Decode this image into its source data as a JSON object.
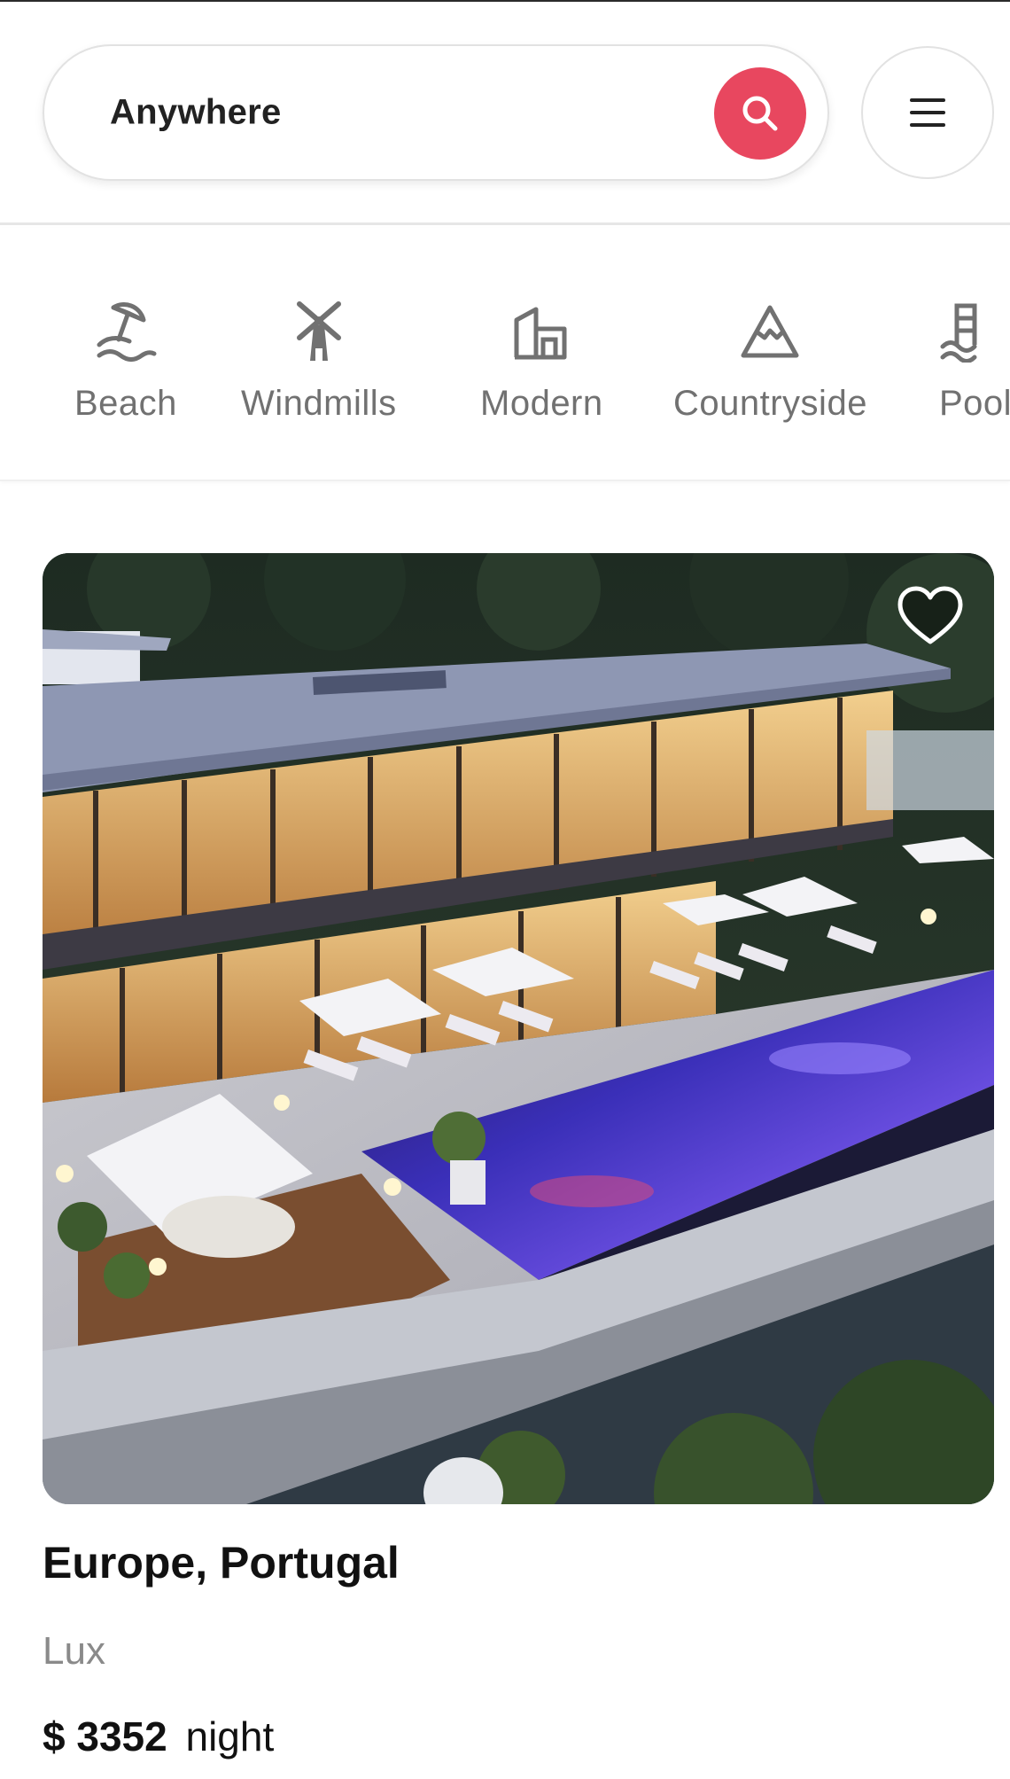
{
  "search": {
    "location_label": "Anywhere",
    "search_icon": "search-icon",
    "menu_icon": "hamburger-menu-icon",
    "accent_color": "#e8475f"
  },
  "categories": [
    {
      "label": "Beach",
      "icon": "beach-umbrella-icon"
    },
    {
      "label": "Windmills",
      "icon": "windmill-icon"
    },
    {
      "label": "Modern",
      "icon": "modern-house-icon"
    },
    {
      "label": "Countryside",
      "icon": "mountain-icon"
    },
    {
      "label": "Pools",
      "icon": "pool-icon"
    }
  ],
  "listing": {
    "image_alt": "Modern villa with infinity pool at dusk",
    "favorite_icon": "heart-icon",
    "title": "Europe, Portugal",
    "category": "Lux",
    "price": "$ 3352",
    "price_unit": "night"
  }
}
